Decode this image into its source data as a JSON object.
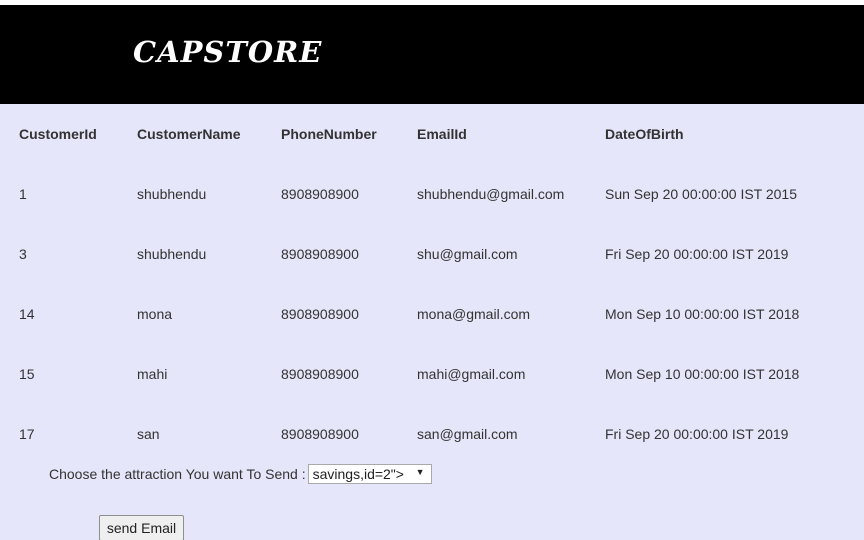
{
  "header": {
    "logo": "CAPSTORE"
  },
  "table": {
    "columns": [
      "CustomerId",
      "CustomerName",
      "PhoneNumber",
      "EmailId",
      "DateOfBirth"
    ],
    "rows": [
      [
        "1",
        "shubhendu",
        "8908908900",
        "shubhendu@gmail.com",
        "Sun Sep 20 00:00:00 IST 2015"
      ],
      [
        "3",
        "shubhendu",
        "8908908900",
        "shu@gmail.com",
        "Fri Sep 20 00:00:00 IST 2019"
      ],
      [
        "14",
        "mona",
        "8908908900",
        "mona@gmail.com",
        "Mon Sep 10 00:00:00 IST 2018"
      ],
      [
        "15",
        "mahi",
        "8908908900",
        "mahi@gmail.com",
        "Mon Sep 10 00:00:00 IST 2018"
      ],
      [
        "17",
        "san",
        "8908908900",
        "san@gmail.com",
        "Fri Sep 20 00:00:00 IST 2019"
      ]
    ]
  },
  "form": {
    "choose_label": "Choose the attraction You want To Send :",
    "selected_option": "savings,id=2\">",
    "send_label": "send Email"
  },
  "colors": {
    "header_bg": "#000000",
    "page_bg": "#e6e6fa"
  }
}
